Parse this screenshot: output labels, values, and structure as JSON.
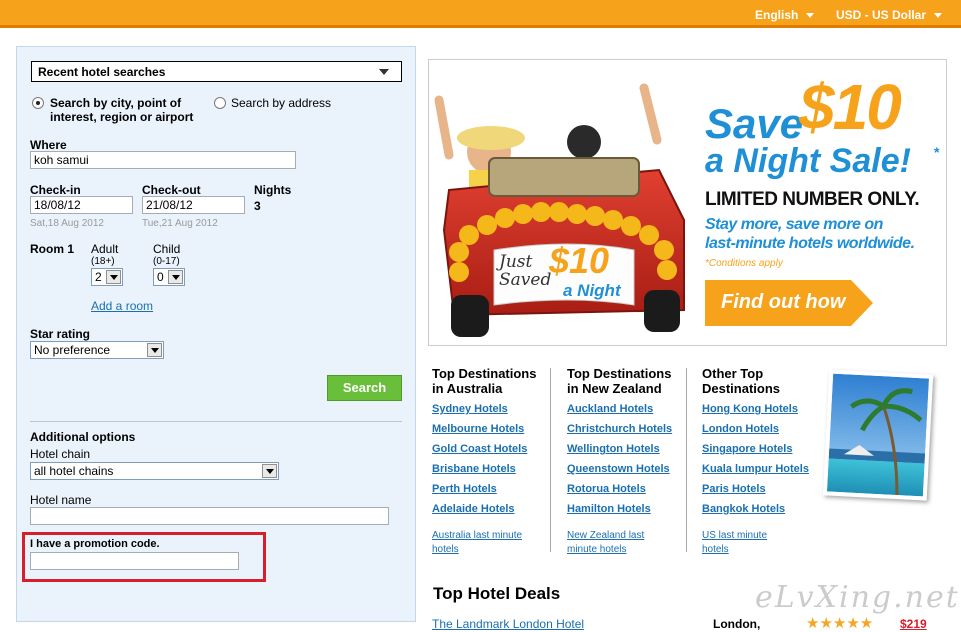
{
  "topbar": {
    "language": "English",
    "currency": "USD - US Dollar"
  },
  "search": {
    "recent_searches": "Recent hotel searches",
    "radio_city_label": "Search by city, point of interest, region or airport",
    "radio_address_label": "Search by address",
    "where_label": "Where",
    "where_value": "koh samui",
    "checkin_label": "Check-in",
    "checkin_value": "18/08/12",
    "checkin_day": "Sat,18 Aug 2012",
    "checkout_label": "Check-out",
    "checkout_value": "21/08/12",
    "checkout_day": "Tue,21 Aug 2012",
    "nights_label": "Nights",
    "nights_value": "3",
    "room_label": "Room 1",
    "adult_label": "Adult",
    "adult_range": "(18+)",
    "adult_value": "2",
    "child_label": "Child",
    "child_range": "(0-17)",
    "child_value": "0",
    "add_room": "Add a room",
    "star_label": "Star rating",
    "star_value": "No preference",
    "search_button": "Search",
    "additional_label": "Additional options",
    "chain_label": "Hotel chain",
    "chain_value": "all hotel chains",
    "hotel_name_label": "Hotel name",
    "hotel_name_value": "",
    "promo_label": "I have a promotion code.",
    "promo_value": ""
  },
  "banner": {
    "headline_save": "Save",
    "headline_amount": "$10",
    "headline_rest": "a Night Sale!",
    "asterisk": "*",
    "limited": "LIMITED NUMBER ONLY.",
    "sub1": "Stay more, save more on",
    "sub2": "last-minute hotels worldwide.",
    "conditions": "*Conditions apply",
    "cta": "Find out how",
    "sign_just": "Just",
    "sign_saved": "Saved",
    "sign_amount": "$10",
    "sign_night": "a Night"
  },
  "destinations": [
    {
      "title1": "Top Destinations",
      "title2": "in Australia",
      "links": [
        "Sydney Hotels",
        "Melbourne Hotels",
        "Gold Coast Hotels",
        "Brisbane Hotels",
        "Perth Hotels",
        "Adelaide Hotels"
      ],
      "more1": "Australia last minute",
      "more2": "hotels"
    },
    {
      "title1": "Top Destinations",
      "title2": "in New Zealand",
      "links": [
        "Auckland Hotels",
        "Christchurch Hotels",
        "Wellington Hotels",
        "Queenstown Hotels",
        "Rotorua Hotels",
        "Hamilton Hotels"
      ],
      "more1": "New Zealand last",
      "more2": "minute hotels"
    },
    {
      "title1": "Other Top",
      "title2": "Destinations",
      "links": [
        "Hong Kong Hotels",
        "London Hotels",
        "Singapore Hotels",
        "Kuala lumpur Hotels",
        "Paris Hotels",
        "Bangkok Hotels"
      ],
      "more1": "US last minute hotels",
      "more2": ""
    }
  ],
  "deals": {
    "title": "Top Hotel Deals",
    "rows": [
      {
        "name": "The Landmark London Hotel",
        "city": "London,",
        "stars": "★★★★★",
        "price": "$219"
      }
    ]
  },
  "watermark": "eLvXing.net",
  "colors": {
    "topbar": "#f7a21b",
    "search_button": "#6abf3a",
    "link": "#1a6fb0",
    "promo_highlight": "#d71f2b",
    "banner_blue": "#1f8fd6",
    "banner_orange": "#f7a21b"
  }
}
